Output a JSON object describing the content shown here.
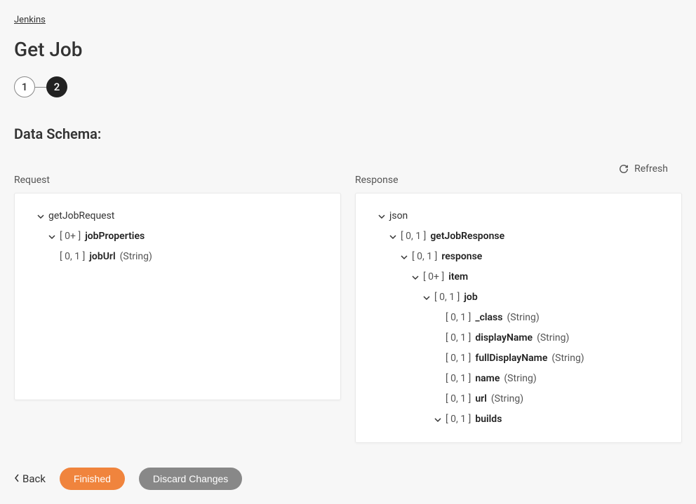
{
  "breadcrumb": "Jenkins",
  "pageTitle": "Get Job",
  "stepper": {
    "step1": "1",
    "step2": "2"
  },
  "sectionHeading": "Data Schema:",
  "refreshLabel": "Refresh",
  "columns": {
    "request": {
      "label": "Request",
      "tree": {
        "root": {
          "name": "getJobRequest"
        },
        "jobProperties": {
          "card": "[ 0+ ]",
          "name": "jobProperties"
        },
        "jobUrl": {
          "card": "[ 0, 1 ]",
          "name": "jobUrl",
          "type": "(String)"
        }
      }
    },
    "response": {
      "label": "Response",
      "tree": {
        "root": {
          "name": "json"
        },
        "getJobResponse": {
          "card": "[ 0, 1 ]",
          "name": "getJobResponse"
        },
        "response": {
          "card": "[ 0, 1 ]",
          "name": "response"
        },
        "item": {
          "card": "[ 0+ ]",
          "name": "item"
        },
        "job": {
          "card": "[ 0, 1 ]",
          "name": "job"
        },
        "class": {
          "card": "[ 0, 1 ]",
          "name": "_class",
          "type": "(String)"
        },
        "displayName": {
          "card": "[ 0, 1 ]",
          "name": "displayName",
          "type": "(String)"
        },
        "fullDisplayName": {
          "card": "[ 0, 1 ]",
          "name": "fullDisplayName",
          "type": "(String)"
        },
        "nameNode": {
          "card": "[ 0, 1 ]",
          "name": "name",
          "type": "(String)"
        },
        "url": {
          "card": "[ 0, 1 ]",
          "name": "url",
          "type": "(String)"
        },
        "builds": {
          "card": "[ 0, 1 ]",
          "name": "builds"
        }
      }
    }
  },
  "actions": {
    "back": "Back",
    "finished": "Finished",
    "discard": "Discard Changes"
  }
}
